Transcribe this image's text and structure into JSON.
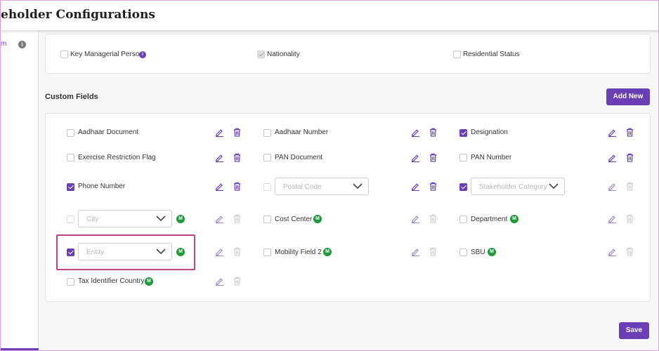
{
  "header": {
    "title": "eholder Configurations"
  },
  "left_panel": {
    "label": "m",
    "info_badge": "i"
  },
  "standard_fields": [
    {
      "label": "Key Managerial Person",
      "checked": false,
      "info_badge": "i"
    },
    {
      "label": "Nationality",
      "checked": true,
      "disabled": true
    },
    {
      "label": "Residential Status",
      "checked": false
    }
  ],
  "custom_fields": {
    "title": "Custom Fields",
    "add_new_label": "Add New",
    "rows": [
      [
        {
          "label": "Aadhaar Document",
          "checked": false
        },
        {
          "label": "Aadhaar Number",
          "checked": false
        },
        {
          "label": "Designation",
          "checked": true
        }
      ],
      [
        {
          "label": "Exercise Restriction Flag",
          "checked": false
        },
        {
          "label": "PAN Document",
          "checked": false
        },
        {
          "label": "PAN Number",
          "checked": false
        }
      ],
      [
        {
          "label": "Phone Number",
          "checked": true
        },
        {
          "placeholder": "Postal Code",
          "checked": false,
          "type": "select"
        },
        {
          "placeholder": "Stakeholder Category",
          "checked": true,
          "type": "select"
        }
      ],
      [
        {
          "placeholder": "City",
          "checked": false,
          "type": "select",
          "badge": "M"
        },
        {
          "label": "Cost Center",
          "checked": false,
          "badge": "M"
        },
        {
          "label": "Department",
          "checked": false,
          "badge": "M"
        }
      ],
      [
        {
          "placeholder": "Entity",
          "checked": true,
          "type": "select",
          "badge": "M"
        },
        {
          "label": "Mobility Field 2",
          "checked": false,
          "badge": "M"
        },
        {
          "label": "SBU",
          "checked": false,
          "badge": "M"
        }
      ],
      [
        {
          "label": "Tax Identifier Country",
          "checked": false,
          "badge": "M"
        }
      ]
    ]
  },
  "save_label": "Save",
  "icons": {
    "edit": "edit-icon",
    "delete": "trash-icon",
    "chevron": "chevron-down-icon"
  },
  "colors": {
    "accent": "#6a3fb5",
    "badge_green": "#1f9a3a",
    "highlight": "#c2408a"
  }
}
